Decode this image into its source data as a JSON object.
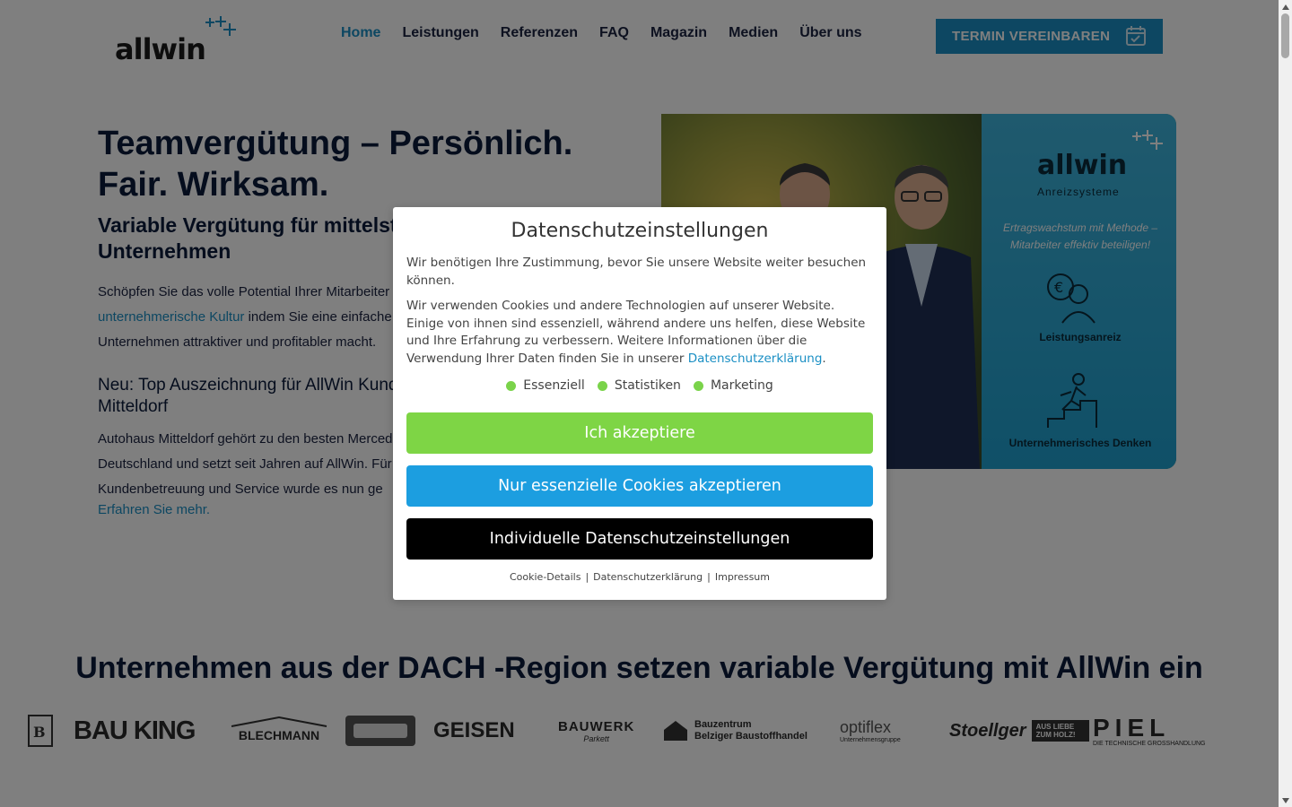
{
  "header": {
    "logo_text": "allwin",
    "nav": [
      "Home",
      "Leistungen",
      "Referenzen",
      "FAQ",
      "Magazin",
      "Medien",
      "Über uns"
    ],
    "cta_label": "TERMIN VEREINBAREN"
  },
  "hero": {
    "title_line1": "Teamvergütung – Persönlich.",
    "title_line2": "Fair. Wirksam.",
    "subtitle_line1": "Variable Vergütung für mittelständische",
    "subtitle_line2": "Unternehmen",
    "p_line1": "Schöpfen Sie das volle Potential Ihrer Mitarbeiter aus,",
    "p_link": "unternehmerische Kultur",
    "p_line2_rest": " indem Sie eine einfache",
    "p_line3": "Unternehmen attraktiver und profitabler macht.",
    "news_title_line1": "Neu: Top Auszeichnung für AllWin Kunde Autohaus",
    "news_title_line2": "Mitteldorf",
    "news_p_line1": "Autohaus Mitteldorf gehört zu den besten Mercedes-",
    "news_p_line2": "Deutschland und setzt seit Jahren auf AllWin. Für",
    "news_p_line3": "Kundenbetreuung und Service wurde es nun ge",
    "news_more": "Erfahren Sie mehr."
  },
  "banner": {
    "logo": "allwin",
    "logo_sub": "Anreizsysteme",
    "tagline_line1": "Ertragswachstum mit Methode –",
    "tagline_line2": "Mitarbeiter effektiv beteiligen!",
    "label1": "Leistungsanreiz",
    "label2": "Unternehmerisches Denken"
  },
  "dach": {
    "title": "Unternehmen aus der DACH -Region setzen variable Vergütung mit AllWin ein",
    "logos": [
      "BAU KING",
      "BLECHMANN",
      "GEISEN",
      "BAUWERK",
      "Parkett",
      "Bauzentrum",
      "Belziger Baustoffhandel",
      "optiflex",
      "Unternehmensgruppe",
      "Stoellger",
      "AUS LIEBE ZUM HOLZ!",
      "PIEL",
      "DIE TECHNISCHE GROSSHANDLUNG"
    ]
  },
  "modal": {
    "title": "Datenschutzeinstellungen",
    "p1": "Wir benötigen Ihre Zustimmung, bevor Sie unsere Website weiter besuchen können.",
    "p2": "Wir verwenden Cookies und andere Technologien auf unserer Website. Einige von ihnen sind essenziell, während andere uns helfen, diese Website und Ihre Erfahrung zu verbessern. Weitere Informationen über die Verwendung Ihrer Daten finden Sie in unserer ",
    "p2_link": "Datenschutzerklärung",
    "p2_end": ".",
    "consents": [
      "Essenziell",
      "Statistiken",
      "Marketing"
    ],
    "btn_accept": "Ich akzeptiere",
    "btn_essential": "Nur essenzielle Cookies akzeptieren",
    "btn_individual": "Individuelle Datenschutzeinstellungen",
    "links": [
      "Cookie-Details",
      "Datenschutzerklärung",
      "Impressum"
    ],
    "link_sep": "|"
  },
  "colors": {
    "accent": "#1a8fc4",
    "accept_green": "#7ed545",
    "essential_blue": "#1c9ee0",
    "navy": "#0a1a3a"
  }
}
